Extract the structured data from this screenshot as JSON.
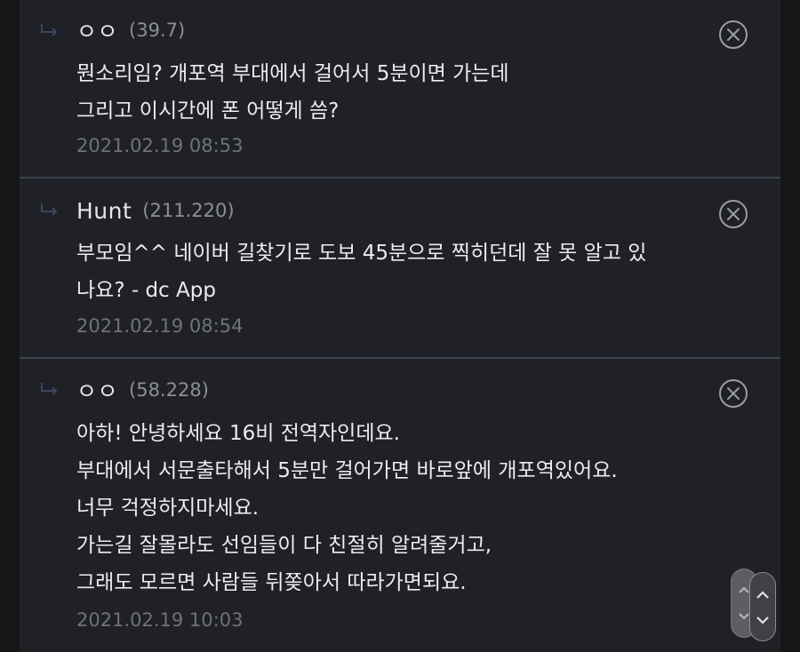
{
  "comments": [
    {
      "author": "ㅇㅇ",
      "ip": "(39.7)",
      "lines": [
        "뭔소리임? 개포역 부대에서 걸어서 5분이면 가는데",
        "그리고 이시간에 폰 어떻게 씀?"
      ],
      "timestamp": "2021.02.19 08:53"
    },
    {
      "author": "Hunt",
      "ip": "(211.220)",
      "lines": [
        "부모임^^ 네이버 길찾기로 도보 45분으로 찍히던데 잘 못 알고 있",
        "나요? - dc App"
      ],
      "timestamp": "2021.02.19 08:54"
    },
    {
      "author": "ㅇㅇ",
      "ip": "(58.228)",
      "lines": [
        "아하! 안녕하세요 16비 전역자인데요.",
        "부대에서 서문출타해서 5분만 걸어가면 바로앞에 개포역있어요.",
        "너무 걱정하지마세요.",
        "가는길 잘몰라도 선임들이 다 친절히 알려줄거고,",
        "그래도 모르면 사람들 뒤쫒아서 따라가면되요."
      ],
      "timestamp": "2021.02.19 10:03"
    }
  ],
  "icons": {
    "reply": "reply-arrow-icon",
    "delete": "close-circle-icon",
    "scroll_up": "chevron-up-icon",
    "scroll_down": "chevron-down-icon"
  },
  "colors": {
    "panel_bg": "#1f2126",
    "divider": "#3a4150",
    "text": "#ececec",
    "meta": "#8c8f96"
  }
}
